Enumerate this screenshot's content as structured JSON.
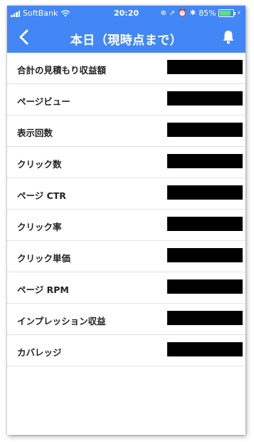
{
  "status_bar": {
    "carrier": "SoftBank",
    "time": "20:20",
    "battery": "85%",
    "battery_level": 0.85
  },
  "navbar": {
    "title": "本日（現時点まで）",
    "back_icon": "chevron-left-icon",
    "bell_icon": "bell-icon"
  },
  "colors": {
    "header": "#4287f5",
    "redaction": "#000000"
  },
  "metrics": [
    {
      "label": "合計の見積もり収益額",
      "value": ""
    },
    {
      "label": "ページビュー",
      "value": ""
    },
    {
      "label": "表示回数",
      "value": ""
    },
    {
      "label": "クリック数",
      "value": ""
    },
    {
      "label": "ページ CTR",
      "value": ""
    },
    {
      "label": "クリック率",
      "value": ""
    },
    {
      "label": "クリック単価",
      "value": ""
    },
    {
      "label": "ページ RPM",
      "value": ""
    },
    {
      "label": "インプレッション収益",
      "value": ""
    },
    {
      "label": "カバレッジ",
      "value": ""
    }
  ]
}
